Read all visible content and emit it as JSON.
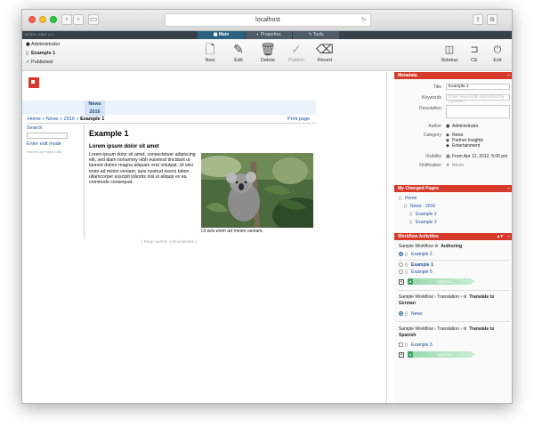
{
  "browser": {
    "url": "localhost"
  },
  "cms": {
    "brand": "MODX CMS 4.1",
    "tabs": [
      {
        "label": "Main"
      },
      {
        "label": "Properties"
      },
      {
        "label": "Tools"
      }
    ]
  },
  "page_info": {
    "user": "Administrator",
    "page": "Example 1",
    "status": "Published"
  },
  "toolbar": {
    "buttons": [
      {
        "label": "New",
        "icon": "new-page-icon"
      },
      {
        "label": "Edit",
        "icon": "pencil-icon"
      },
      {
        "label": "Delete",
        "icon": "trash-icon"
      },
      {
        "label": "Publish",
        "icon": "check-circle-icon"
      },
      {
        "label": "Revert",
        "icon": "eraser-icon"
      }
    ],
    "right_buttons": [
      {
        "label": "Sidebar",
        "icon": "sidebar-icon"
      },
      {
        "label": "CE",
        "icon": "folder-icon"
      },
      {
        "label": "Exit",
        "icon": "power-icon"
      }
    ]
  },
  "content": {
    "news_tab": {
      "line1": "News",
      "line2": "2016"
    },
    "breadcrumb": {
      "home": "Home",
      "news": "News",
      "year": "2016",
      "current": "Example 1",
      "sep": " » "
    },
    "print_label": "Print page",
    "sidebar": {
      "search": "Search",
      "edit_mode": "Enter edit mode",
      "powered": "Powered by Project CMS"
    },
    "title": "Example 1",
    "heading": "Lorem ipsum dolor sit amet",
    "body": "Lorem ipsum dolor sit amet, consectetuer adipiscing elit, sed diam nonummy nibh euismod tincidunt ut laoreet dolore magna aliquam erat volutpat. Ut wisi enim ad minim veniam, quis nostrud exerci tation ullamcorper suscipit lobortis nisl ut aliquip ex ea commodo consequat.",
    "caption": "Ut wisi enim ad minim veniam.",
    "page_author": "[ Page author: Administrator ]"
  },
  "metadata": {
    "header": "Metadata",
    "title_label": "Title",
    "title_value": "Example 1",
    "keywords_label": "Keywords",
    "keywords_placeholder": "Enter keywords separated by comma...",
    "description_label": "Description",
    "author_label": "Author",
    "author_value": "Administrator",
    "category_label": "Category",
    "categories": [
      "News",
      "Partner Insights",
      "Entertainment"
    ],
    "visibility_label": "Visibility",
    "visibility_value": "From Apr 12, 2012, 5:00 pm",
    "notification_label": "Notification",
    "notification_value": "Never"
  },
  "changed_pages": {
    "header": "My Changed Pages",
    "home": "Home",
    "path": "News · 2016",
    "items": [
      "Example 2",
      "Example 3"
    ]
  },
  "workflow": {
    "header": "Workflow Activities",
    "groups": [
      {
        "name": "Sample Workflow",
        "step": "Authoring",
        "items": [
          "Example 2",
          "Example 1",
          "Example 5"
        ],
        "approve": "Approve"
      },
      {
        "name": "Sample Workflow",
        "mid": "Translation",
        "step": "Translate to German",
        "items": [
          "News"
        ]
      },
      {
        "name": "Sample Workflow",
        "mid": "Translation",
        "step": "Translate to Spanish",
        "items": [
          "Example 3"
        ],
        "approve": "Approve"
      }
    ]
  }
}
